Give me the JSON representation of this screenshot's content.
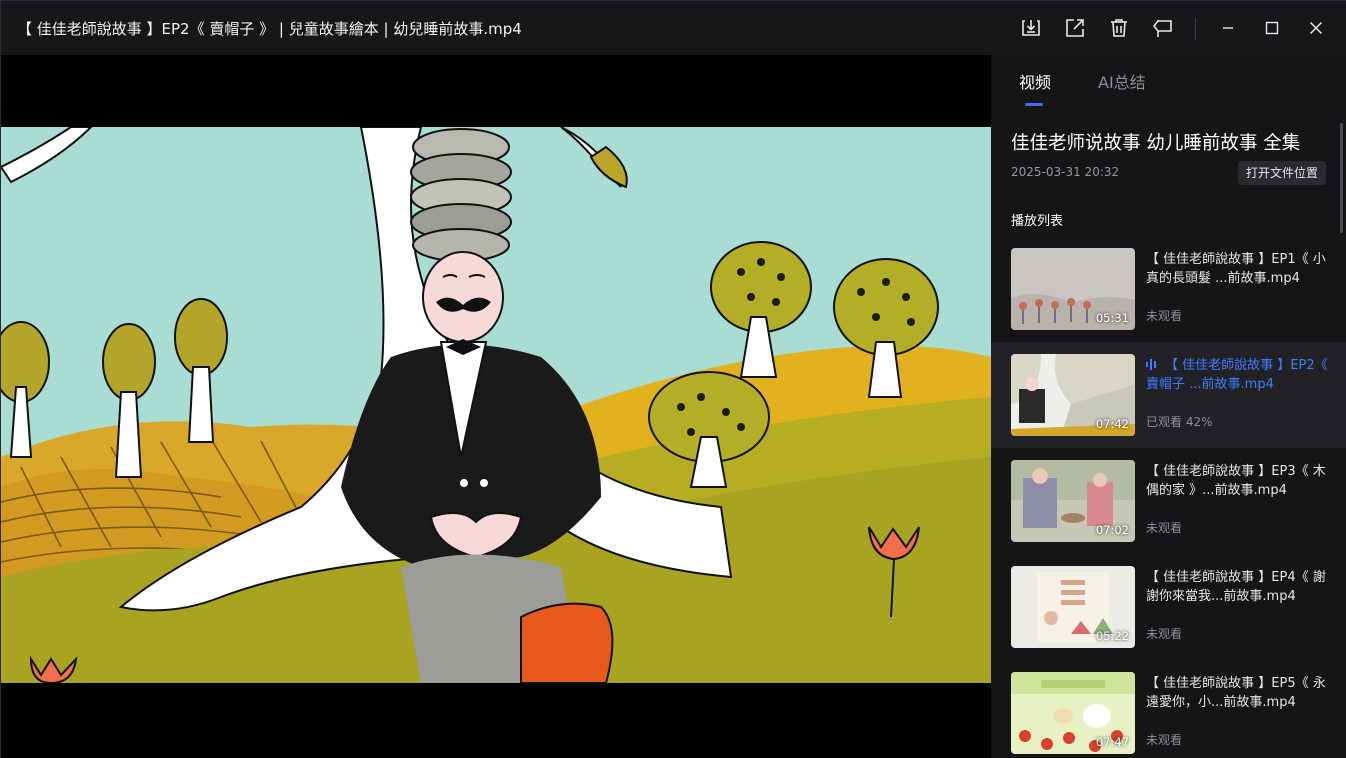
{
  "window": {
    "title": "【 佳佳老師說故事 】EP2《 賣帽子 》 | 兒童故事繪本 | 幼兒睡前故事.mp4"
  },
  "titlebar_icons": [
    "download-icon",
    "share-icon",
    "delete-icon",
    "pin-icon",
    "minimize-icon",
    "maximize-icon",
    "close-icon"
  ],
  "sidebar": {
    "tabs": [
      {
        "label": "视频",
        "active": true
      },
      {
        "label": "AI总结",
        "active": false
      }
    ],
    "collection_title": "佳佳老师说故事 幼儿睡前故事 全集",
    "collection_date": "2025-03-31 20:32",
    "open_folder_label": "打开文件位置",
    "playlist_label": "播放列表",
    "items": [
      {
        "title": "【 佳佳老師說故事 】EP1《 小真的長頭髮 ...前故事.mp4",
        "duration": "05:31",
        "status": "未观看",
        "active": false
      },
      {
        "title": "【 佳佳老師說故事 】EP2《 賣帽子 ...前故事.mp4",
        "duration": "07:42",
        "status": "已观看 42%",
        "active": true,
        "progress": 0.42
      },
      {
        "title": "【 佳佳老師說故事 】EP3《 木偶的家 》...前故事.mp4",
        "duration": "07:02",
        "status": "未观看",
        "active": false
      },
      {
        "title": "【 佳佳老師說故事 】EP4《 謝謝你來當我...前故事.mp4",
        "duration": "05:22",
        "status": "未观看",
        "active": false
      },
      {
        "title": "【 佳佳老師說故事 】EP5《 永遠愛你，小...前故事.mp4",
        "duration": "07:47",
        "status": "未观看",
        "active": false
      }
    ]
  },
  "colors": {
    "accent": "#3d6cf5",
    "active_text": "#3f7cff",
    "background": "#0c0c0e",
    "sidebar": "#151517"
  }
}
